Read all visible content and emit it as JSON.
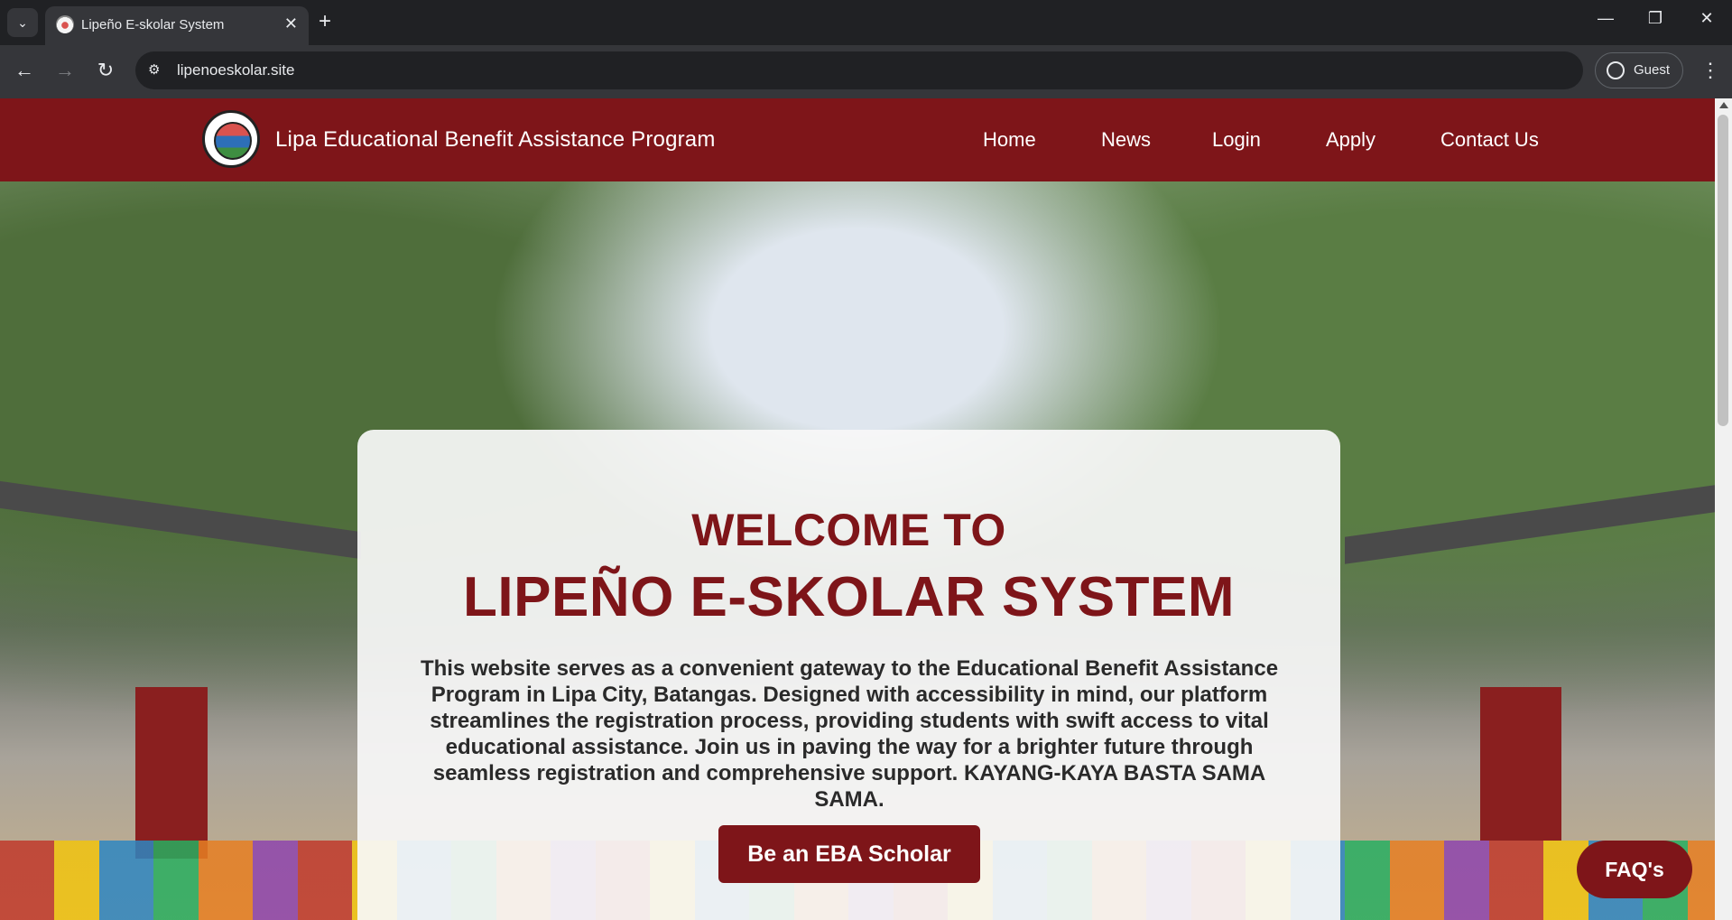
{
  "browser": {
    "tab_title": "Lipeño E-skolar System",
    "url": "lipenoeskolar.site",
    "profile_label": "Guest"
  },
  "header": {
    "site_title": "Lipa Educational Benefit Assistance Program",
    "nav": [
      "Home",
      "News",
      "Login",
      "Apply",
      "Contact Us"
    ]
  },
  "hero": {
    "welcome_line1": "WELCOME TO",
    "welcome_line2": "LIPEÑO E-SKOLAR SYSTEM",
    "description": "This website serves as a convenient gateway to the Educational Benefit Assistance Program in Lipa City, Batangas. Designed with accessibility in mind, our platform streamlines the registration process, providing students with swift access to vital educational assistance. Join us in paving the way for a brighter future through seamless registration and comprehensive support. KAYANG-KAYA BASTA SAMA SAMA.",
    "cta_label": "Be an EBA Scholar"
  },
  "faq_label": "FAQ's",
  "colors": {
    "brand": "#7e1519",
    "card": "#f8f8f8"
  }
}
